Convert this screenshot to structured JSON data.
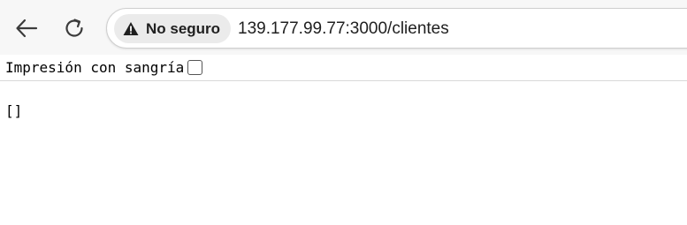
{
  "toolbar": {
    "back_icon": "arrow-left-icon",
    "reload_icon": "reload-icon"
  },
  "omnibox": {
    "security_icon": "warning-triangle-icon",
    "security_label": "No seguro",
    "url": "139.177.99.77:3000/clientes"
  },
  "pretty_print": {
    "label": "Impresión con sangría",
    "checked": false
  },
  "page": {
    "content": "[]"
  }
}
